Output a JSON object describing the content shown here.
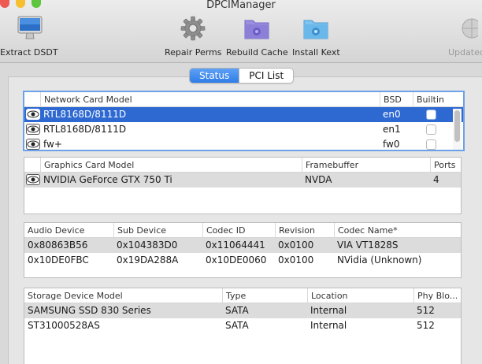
{
  "window": {
    "title": "DPCIManager"
  },
  "toolbar": {
    "extract": "Extract DSDT",
    "repair": "Repair Perms",
    "rebuild": "Rebuild Cache",
    "install": "Install Kext",
    "updated": "Updated"
  },
  "tabs": {
    "status": "Status",
    "pci": "PCI List"
  },
  "network": {
    "headers": {
      "model": "Network Card Model",
      "bsd": "BSD",
      "builtin": "Builtin"
    },
    "rows": [
      {
        "model": "RTL8168D/8111D",
        "bsd": "en0"
      },
      {
        "model": "RTL8168D/8111D",
        "bsd": "en1"
      },
      {
        "model": "fw+",
        "bsd": "fw0"
      }
    ]
  },
  "graphics": {
    "headers": {
      "model": "Graphics Card Model",
      "fb": "Framebuffer",
      "ports": "Ports"
    },
    "rows": [
      {
        "model": "NVIDIA GeForce GTX 750 Ti",
        "fb": "NVDA",
        "ports": "4"
      }
    ]
  },
  "audio": {
    "headers": {
      "device": "Audio Device",
      "sub": "Sub Device",
      "codec": "Codec ID",
      "rev": "Revision",
      "name": "Codec Name*"
    },
    "rows": [
      {
        "device": "0x80863B56",
        "sub": "0x104383D0",
        "codec": "0x11064441",
        "rev": "0x0100",
        "name": "VIA VT1828S"
      },
      {
        "device": "0x10DE0FBC",
        "sub": "0x19DA288A",
        "codec": "0x10DE0060",
        "rev": "0x0100",
        "name": "NVidia (Unknown)"
      }
    ]
  },
  "storage": {
    "headers": {
      "model": "Storage Device Model",
      "type": "Type",
      "location": "Location",
      "phy": "Phy Blo..."
    },
    "rows": [
      {
        "model": "SAMSUNG SSD 830 Series",
        "type": "SATA",
        "location": "Internal",
        "phy": "512"
      },
      {
        "model": "ST31000528AS",
        "type": "SATA",
        "location": "Internal",
        "phy": "512"
      }
    ]
  },
  "colors": {
    "selection": "#2e69d2",
    "accent": "#2f7de8"
  }
}
